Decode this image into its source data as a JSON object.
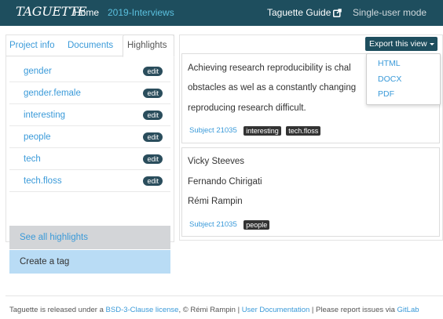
{
  "navbar": {
    "brand": "TAGUETTE",
    "home": "Home",
    "project": "2019-Interviews",
    "guide": "Taguette Guide",
    "mode": "Single-user mode"
  },
  "tabs": {
    "project_info": "Project info",
    "documents": "Documents",
    "highlights": "Highlights"
  },
  "highlights": {
    "edit_label": "edit",
    "items": [
      {
        "label": "gender"
      },
      {
        "label": "gender.female"
      },
      {
        "label": "interesting"
      },
      {
        "label": "people"
      },
      {
        "label": "tech"
      },
      {
        "label": "tech.floss"
      }
    ],
    "see_all": "See all highlights",
    "create_tag": "Create a tag"
  },
  "export": {
    "button": "Export this view",
    "options": [
      "HTML",
      "DOCX",
      "PDF"
    ]
  },
  "cards": [
    {
      "lines": [
        "Achieving research reproducibility is chal",
        "obstacles as wel  as a constantly changing",
        "reproducing research difficult."
      ],
      "subject": "Subject 21035",
      "tags": [
        "interesting",
        "tech.floss"
      ]
    },
    {
      "lines": [
        "Vicky Steeves",
        "Fernando Chirigati",
        "Rémi Rampin"
      ],
      "subject": "Subject 21035",
      "tags": [
        "people"
      ]
    }
  ],
  "footer": {
    "p1": "Taguette is released under a ",
    "license": "BSD-3-Clause license",
    "p2": ", © Rémi Rampin | ",
    "docs": "User Documentation",
    "p3": " | Please report issues via ",
    "gitlab": "GitLab"
  },
  "colors": {
    "navbar": "#1e4e5e",
    "link": "#3a9ad9",
    "edit_badge": "#2a4d5c",
    "create_tag_bg": "#b9dcf5",
    "see_all_bg": "#d3d5d8"
  }
}
